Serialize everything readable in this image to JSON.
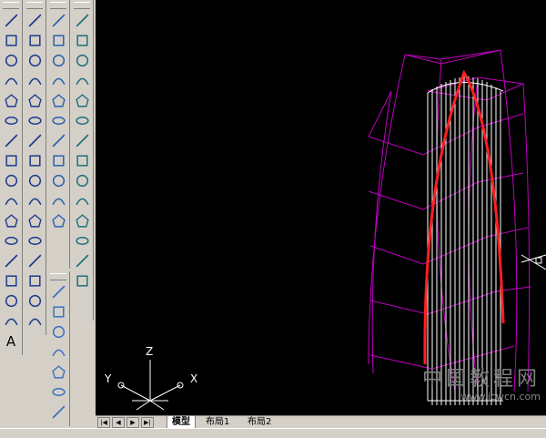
{
  "toolbar_draw": {
    "items": [
      "line-icon",
      "construction-line-icon",
      "polyline-icon",
      "polygon-icon",
      "rectangle-icon",
      "arc-icon",
      "circle-icon",
      "revision-cloud-icon",
      "spline-icon",
      "ellipse-icon",
      "ellipse-arc-icon",
      "insert-block-icon",
      "make-block-icon",
      "point-icon",
      "hatch-icon",
      "region-icon",
      "multiline-text-icon"
    ],
    "text_tool_label": "A"
  },
  "toolbar_modify": {
    "items": [
      "erase-icon",
      "copy-icon",
      "mirror-icon",
      "offset-icon",
      "array-icon",
      "move-icon",
      "rotate-icon",
      "scale-icon",
      "stretch-icon",
      "trim-icon",
      "extend-icon",
      "break-icon",
      "join-icon",
      "chamfer-icon",
      "fillet-icon",
      "explode-icon"
    ]
  },
  "toolbar_view": {
    "items": [
      "top-view-icon",
      "bottom-view-icon",
      "left-view-icon",
      "right-view-icon",
      "front-view-icon",
      "back-view-icon",
      "sw-iso-icon",
      "se-iso-icon",
      "ne-iso-icon",
      "nw-iso-icon",
      "camera-icon"
    ]
  },
  "toolbar_shade": {
    "items": [
      "2d-wireframe-icon",
      "3d-wireframe-icon",
      "hidden-icon",
      "flat-shaded-icon",
      "gouraud-shaded-icon",
      "flat-edges-icon",
      "gouraud-edges-icon"
    ]
  },
  "toolbar_ucs": {
    "items": [
      "ucs-icon",
      "ucs-world-icon",
      "ucs-previous-icon",
      "ucs-face-icon",
      "ucs-object-icon",
      "ucs-view-icon",
      "ucs-origin-icon",
      "ucs-zaxis-icon",
      "ucs-3point-icon",
      "ucs-x-icon",
      "ucs-y-icon",
      "ucs-z-icon",
      "ucs-apply-icon",
      "named-ucs-icon"
    ],
    "z_rotate_sup": "3"
  },
  "viewport": {
    "ucs_labels": {
      "z": "Z",
      "x": "X",
      "y": "Y"
    },
    "colors": {
      "background": "#000000",
      "wireframe": "#c000c0",
      "lines": "#ffffff",
      "curve": "#ff2020"
    }
  },
  "tabs": {
    "nav": [
      "|◀",
      "◀",
      "▶",
      "▶|"
    ],
    "items": [
      {
        "label": "模型",
        "active": true
      },
      {
        "label": "布局1",
        "active": false
      },
      {
        "label": "布局2",
        "active": false
      }
    ]
  },
  "watermark": {
    "text": "中国教程网",
    "url": "www.jcwcn.com"
  }
}
